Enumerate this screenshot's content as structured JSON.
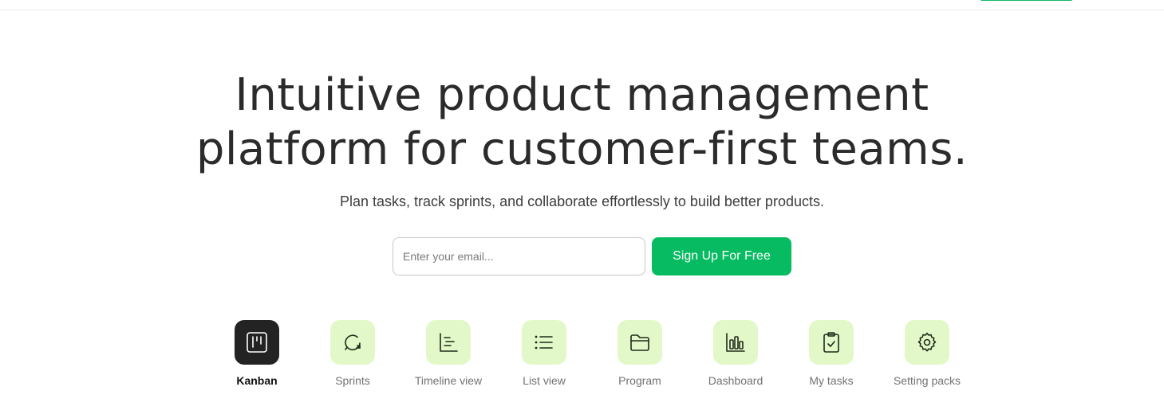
{
  "hero": {
    "title_line1": "Intuitive product management",
    "title_line2": "platform for customer-first teams.",
    "subtitle": "Plan tasks, track sprints, and collaborate effortlessly to build better products."
  },
  "signup": {
    "email_placeholder": "Enter your email...",
    "email_value": "",
    "button_label": "Sign Up For Free"
  },
  "colors": {
    "accent": "#07bb62",
    "tile_bg": "#e3f8c9",
    "active_tile_bg": "#232323"
  },
  "features": [
    {
      "label": "Kanban",
      "icon": "kanban-icon",
      "active": true
    },
    {
      "label": "Sprints",
      "icon": "sprint-cycle-icon",
      "active": false
    },
    {
      "label": "Timeline view",
      "icon": "timeline-icon",
      "active": false
    },
    {
      "label": "List view",
      "icon": "list-icon",
      "active": false
    },
    {
      "label": "Program",
      "icon": "folder-icon",
      "active": false
    },
    {
      "label": "Dashboard",
      "icon": "bar-chart-icon",
      "active": false
    },
    {
      "label": "My tasks",
      "icon": "clipboard-check-icon",
      "active": false
    },
    {
      "label": "Setting packs",
      "icon": "gear-icon",
      "active": false
    }
  ]
}
